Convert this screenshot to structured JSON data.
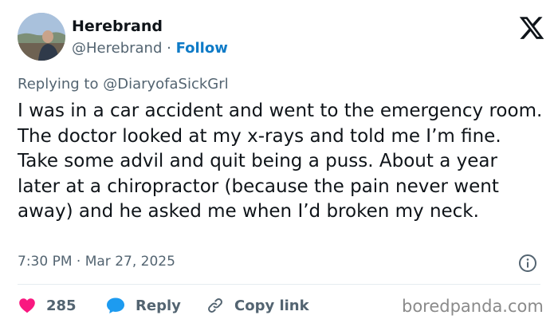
{
  "user": {
    "name": "Herebrand",
    "handle": "@Herebrand",
    "separator": " · ",
    "follow_label": "Follow"
  },
  "reply": {
    "prefix": "Replying to ",
    "mention": "@DiaryofaSickGrl"
  },
  "tweet": {
    "text": "I was in a car accident and went to the emergency room. The doctor looked at my x-rays and told me I’m fine. Take some advil and quit being a puss. About a year later at a chiropractor (because the pain never went away) and he asked me when I’d broken my neck."
  },
  "meta": {
    "time": "7:30 PM",
    "separator": " · ",
    "date": "Mar 27, 2025"
  },
  "actions": {
    "like_count": "285",
    "reply_label": "Reply",
    "copy_label": "Copy link"
  },
  "watermark": "boredpanda.com",
  "colors": {
    "like": "#f91880",
    "reply": "#1d9bf0",
    "follow": "#0f7bc7",
    "muted": "#536471"
  },
  "icons": {
    "brand": "x-logo-icon",
    "info": "info-icon",
    "like": "heart-icon",
    "reply": "speech-bubble-icon",
    "copy": "link-icon"
  }
}
